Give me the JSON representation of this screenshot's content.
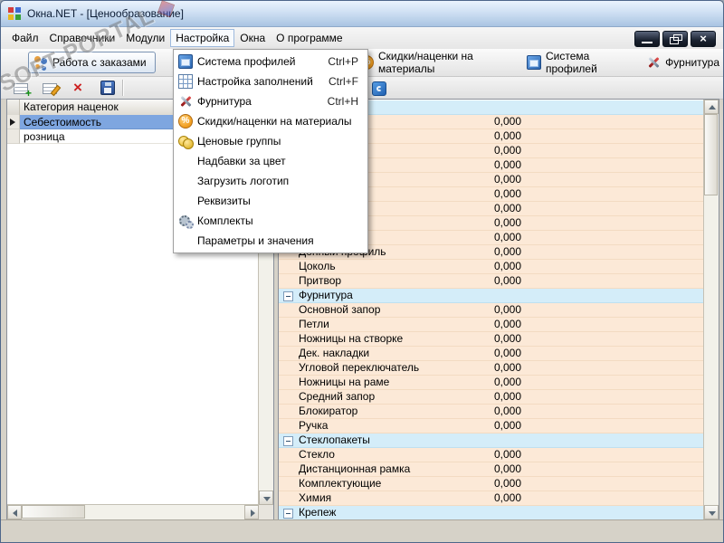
{
  "window": {
    "title": "Окна.NET - [Ценообразование]"
  },
  "watermark": {
    "text": "SOFT-PORTAL"
  },
  "menu_bar": {
    "items": [
      "Файл",
      "Справочники",
      "Модули",
      "Настройка",
      "Окна",
      "О программе"
    ],
    "active_index": 3
  },
  "window_controls": {
    "icons": [
      "minimize-icon",
      "restore-icon",
      "close-icon"
    ]
  },
  "dropdown_menu": {
    "items": [
      {
        "label": "Система профилей",
        "shortcut": "Ctrl+P",
        "icon": "profiles-icon"
      },
      {
        "label": "Настройка заполнений",
        "shortcut": "Ctrl+F",
        "icon": "fill-settings-icon"
      },
      {
        "label": "Фурнитура",
        "shortcut": "Ctrl+H",
        "icon": "furniture-icon"
      },
      {
        "label": "Скидки/наценки на материалы",
        "shortcut": "",
        "icon": "discounts-icon"
      },
      {
        "label": "Ценовые группы",
        "shortcut": "",
        "icon": "price-groups-icon"
      },
      {
        "label": "Надбавки за цвет",
        "shortcut": "",
        "icon": ""
      },
      {
        "label": "Загрузить логотип",
        "shortcut": "",
        "icon": ""
      },
      {
        "label": "Реквизиты",
        "shortcut": "",
        "icon": ""
      },
      {
        "label": "Комплекты",
        "shortcut": "",
        "icon": "kits-icon"
      },
      {
        "label": "Параметры и значения",
        "shortcut": "",
        "icon": ""
      }
    ]
  },
  "toolbar": {
    "orders_button": {
      "label": "Работа с заказами",
      "icon": "orders-icon"
    },
    "right_buttons": [
      {
        "label": "Скидки/наценки на материалы",
        "icon": "discounts-icon"
      },
      {
        "label": "Система профилей",
        "icon": "profiles-icon"
      },
      {
        "label": "Фурнитура",
        "icon": "furniture-icon"
      }
    ]
  },
  "toolbar2": {
    "left_icons": [
      "add-record-icon",
      "edit-record-icon",
      "delete-record-icon",
      "save-icon"
    ],
    "right_icons": [
      "blue-tool-icon"
    ]
  },
  "left_grid": {
    "header": "Категория наценок",
    "rows": [
      {
        "label": "Себестоимость",
        "selected": true
      },
      {
        "label": "розница",
        "selected": false
      }
    ]
  },
  "right_grid": {
    "rows": [
      {
        "type": "group",
        "label": "",
        "value": ""
      },
      {
        "type": "item",
        "label": "",
        "value": "0,000"
      },
      {
        "type": "item",
        "label": "",
        "value": "0,000"
      },
      {
        "type": "item",
        "label": "",
        "value": "0,000"
      },
      {
        "type": "item",
        "label": "",
        "value": "0,000"
      },
      {
        "type": "item",
        "label": "",
        "value": "0,000"
      },
      {
        "type": "item",
        "label": "",
        "value": "0,000"
      },
      {
        "type": "item",
        "label": "",
        "value": "0,000"
      },
      {
        "type": "item",
        "label": "",
        "value": "0,000"
      },
      {
        "type": "item",
        "label": "",
        "value": "0,000"
      },
      {
        "type": "item",
        "label": "Донный профиль",
        "value": "0,000"
      },
      {
        "type": "item",
        "label": "Цоколь",
        "value": "0,000"
      },
      {
        "type": "item",
        "label": "Притвор",
        "value": "0,000"
      },
      {
        "type": "group",
        "label": "Фурнитура",
        "value": ""
      },
      {
        "type": "item",
        "label": "Основной запор",
        "value": "0,000"
      },
      {
        "type": "item",
        "label": "Петли",
        "value": "0,000"
      },
      {
        "type": "item",
        "label": "Ножницы на створке",
        "value": "0,000"
      },
      {
        "type": "item",
        "label": "Дек. накладки",
        "value": "0,000"
      },
      {
        "type": "item",
        "label": "Угловой переключатель",
        "value": "0,000"
      },
      {
        "type": "item",
        "label": "Ножницы на раме",
        "value": "0,000"
      },
      {
        "type": "item",
        "label": "Средний запор",
        "value": "0,000"
      },
      {
        "type": "item",
        "label": "Блокиратор",
        "value": "0,000"
      },
      {
        "type": "item",
        "label": "Ручка",
        "value": "0,000"
      },
      {
        "type": "group",
        "label": "Стеклопакеты",
        "value": ""
      },
      {
        "type": "item",
        "label": "Стекло",
        "value": "0,000"
      },
      {
        "type": "item",
        "label": "Дистанционная рамка",
        "value": "0,000"
      },
      {
        "type": "item",
        "label": "Комплектующие",
        "value": "0,000"
      },
      {
        "type": "item",
        "label": "Химия",
        "value": "0,000"
      },
      {
        "type": "group",
        "label": "Крепеж",
        "value": ""
      }
    ]
  }
}
